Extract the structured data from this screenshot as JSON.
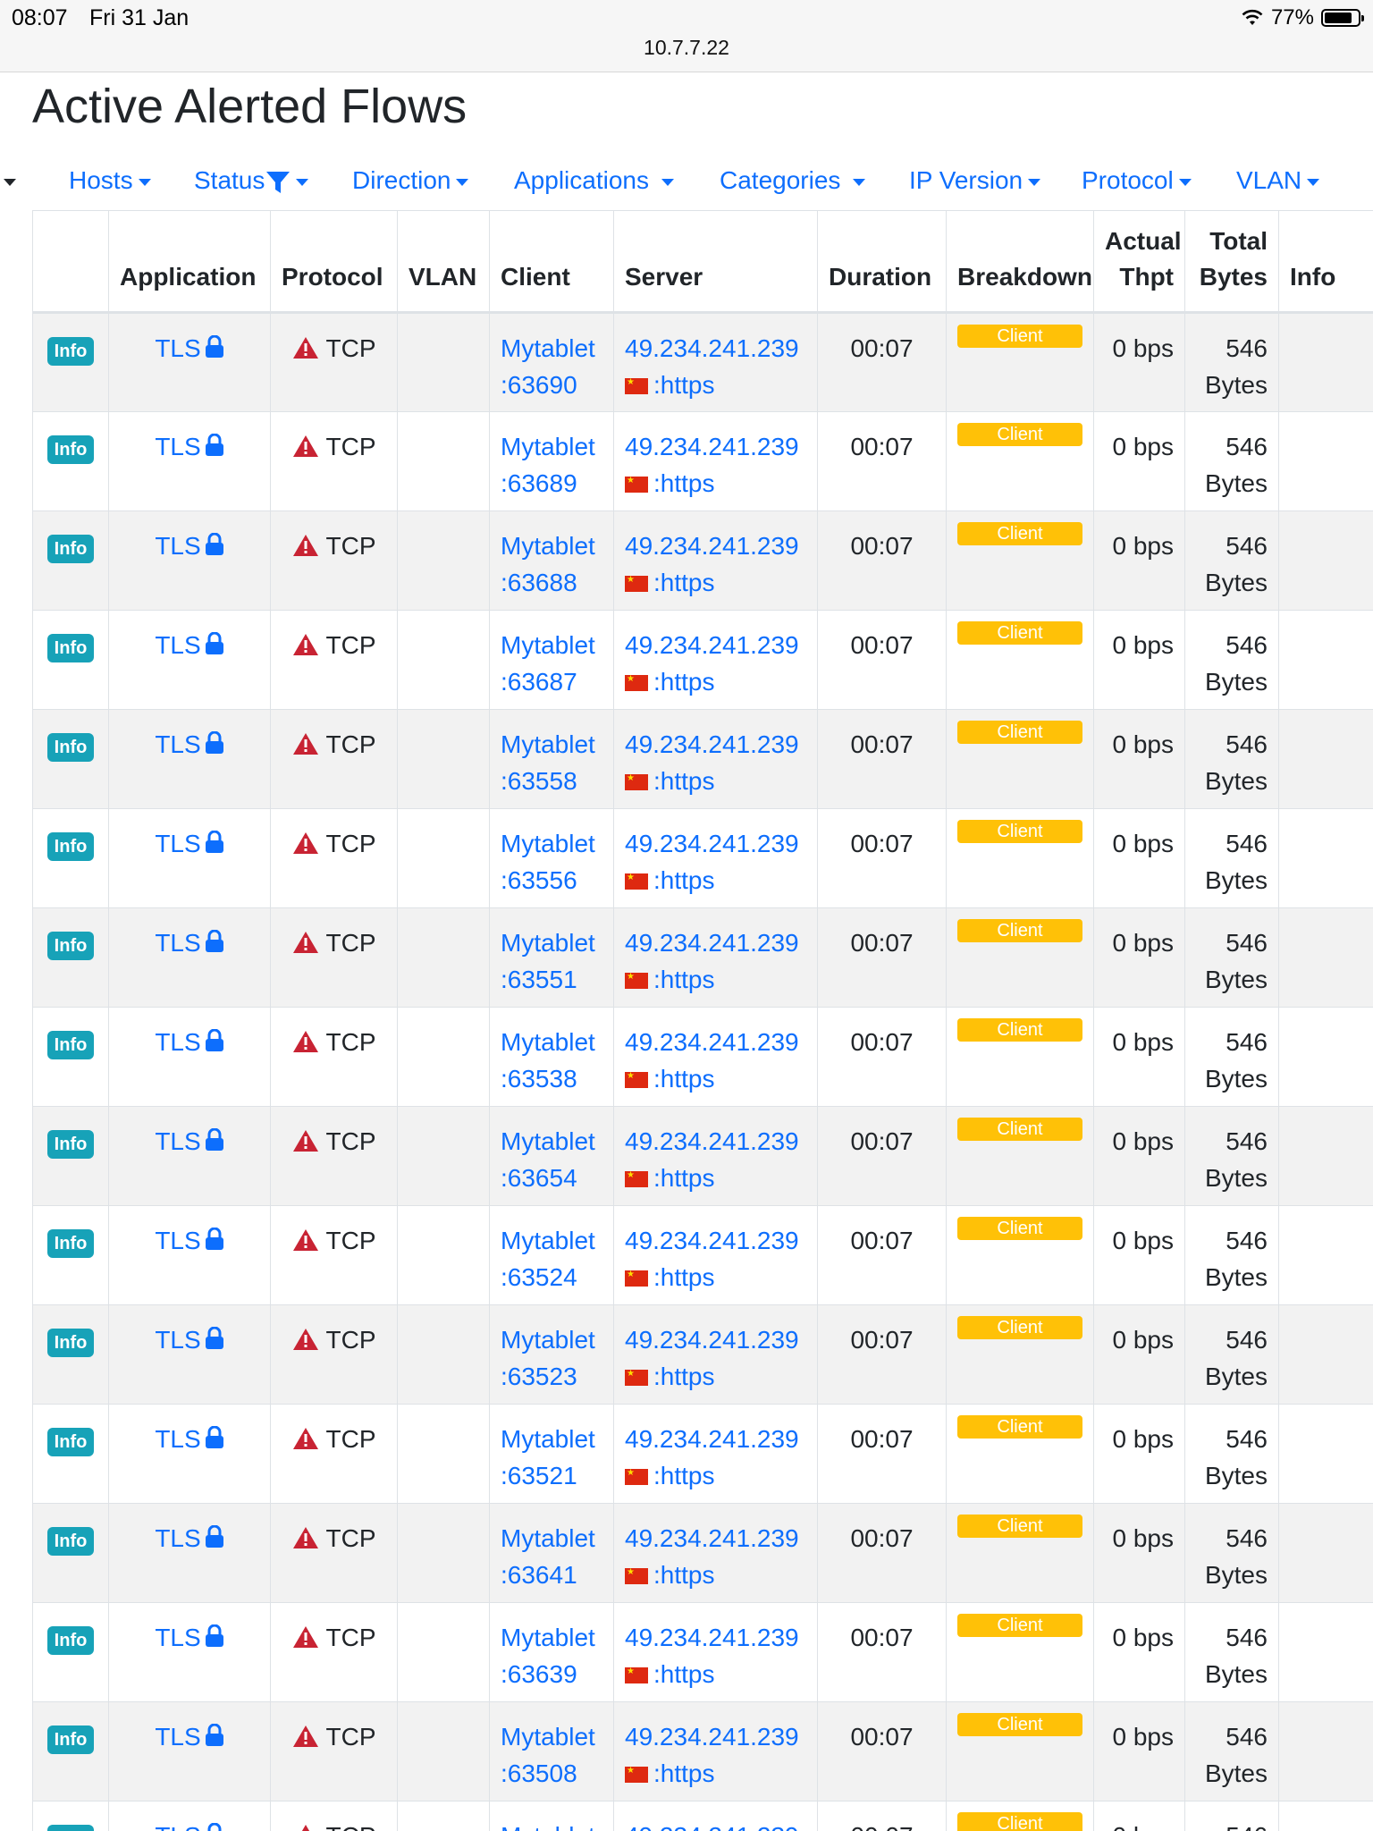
{
  "status_bar": {
    "time": "08:07",
    "date": "Fri 31 Jan",
    "url": "10.7.7.22",
    "battery": "77%"
  },
  "page": {
    "title": "Active Alerted Flows"
  },
  "filters": [
    {
      "label": "Hosts"
    },
    {
      "label": "Status"
    },
    {
      "label": "Direction"
    },
    {
      "label": "Applications"
    },
    {
      "label": "Categories"
    },
    {
      "label": "IP Version"
    },
    {
      "label": "Protocol"
    },
    {
      "label": "VLAN"
    }
  ],
  "table": {
    "headers": {
      "application": "Application",
      "protocol": "Protocol",
      "vlan": "VLAN",
      "client": "Client",
      "server": "Server",
      "duration": "Duration",
      "breakdown": "Breakdown",
      "thpt_line1": "Actual",
      "thpt_line2": "Thpt",
      "bytes_line1": "Total",
      "bytes_line2": "Bytes",
      "info": "Info"
    },
    "rows": [
      {
        "port": ":63690"
      },
      {
        "port": ":63689"
      },
      {
        "port": ":63688"
      },
      {
        "port": ":63687"
      },
      {
        "port": ":63558"
      },
      {
        "port": ":63556"
      },
      {
        "port": ":63551"
      },
      {
        "port": ":63538"
      },
      {
        "port": ":63654"
      },
      {
        "port": ":63524"
      },
      {
        "port": ":63523"
      },
      {
        "port": ":63521"
      },
      {
        "port": ":63641"
      },
      {
        "port": ":63639"
      },
      {
        "port": ":63508"
      },
      {
        "port": ""
      }
    ],
    "common": {
      "info_badge": "Info",
      "application": "TLS",
      "protocol": "TCP",
      "client_host": "Mytablet",
      "server_ip": "49.234.241.239",
      "server_port": ":https",
      "duration": "00:07",
      "breakdown": "Client",
      "thpt": "0 bps",
      "bytes_value": "546",
      "bytes_unit": "Bytes"
    }
  }
}
